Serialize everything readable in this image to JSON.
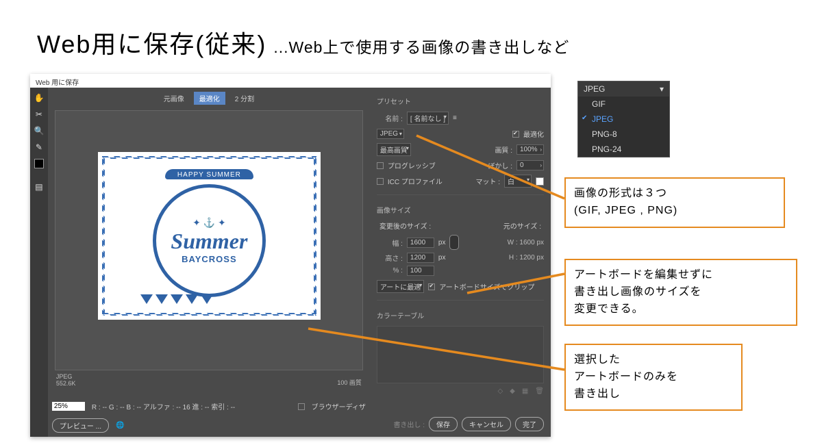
{
  "title": {
    "main": "Web用に保存(従来)",
    "sub": "...Web上で使用する画像の書き出しなど"
  },
  "window_title": "Web 用に保存",
  "tabs": {
    "original": "元画像",
    "optimized": "最適化",
    "two_up": "2 分割"
  },
  "status": {
    "format": "JPEG",
    "size": "552.6K",
    "quality_line": "100 画質"
  },
  "zoom": "25%",
  "readout": "R : -- G : -- B : -- アルファ : -- 16 進 : -- 索引 : --",
  "browser_dither": "ブラウザーディザ",
  "buttons": {
    "preview": "プレビュー ...",
    "save": "保存",
    "cancel": "キャンセル",
    "done": "完了",
    "export_label": "書き出し :"
  },
  "preset": {
    "section": "プリセット",
    "name_label": "名前 :",
    "name_value": "[ 名前なし ]",
    "format": "JPEG",
    "optimized_label": "最適化",
    "quality_preset": "最高画質",
    "quality_label": "画質 :",
    "quality_value": "100%",
    "progressive": "プログレッシブ",
    "blur_label": "ぼかし :",
    "blur_value": "0",
    "icc": "ICC プロファイル",
    "matte_label": "マット :",
    "matte_value": "白"
  },
  "image_size": {
    "section": "画像サイズ",
    "after_label": "変更後のサイズ :",
    "orig_label": "元のサイズ :",
    "w_label": "幅 :",
    "w_value": "1600",
    "w_orig": "W : 1600 px",
    "h_label": "高さ :",
    "h_value": "1200",
    "h_orig": "H : 1200 px",
    "pct_label": "% :",
    "pct_value": "100",
    "px": "px",
    "fit": "アートに最適",
    "clip_label": "アートボードサイズでクリップ"
  },
  "color_table": "カラーテーブル",
  "dropdown": {
    "head": "JPEG",
    "items": [
      "GIF",
      "JPEG",
      "PNG-8",
      "PNG-24"
    ],
    "selected": "JPEG"
  },
  "annot": {
    "a1_l1": "画像の形式は３つ",
    "a1_l2": "(GIF, JPEG , PNG)",
    "a2_l1": "アートボードを編集せずに",
    "a2_l2": "書き出し画像のサイズを",
    "a2_l3": "変更できる。",
    "a3_l1": "選択した",
    "a3_l2": "アートボードのみを",
    "a3_l3": "書き出し"
  },
  "logo": {
    "top": "HAPPY SUMMER",
    "summer": "Summer",
    "bay": "BAYCROSS"
  }
}
